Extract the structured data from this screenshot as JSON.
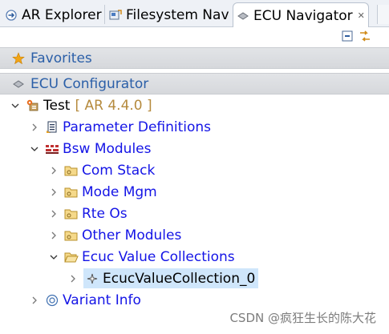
{
  "tabs": [
    {
      "label": "AR Explorer",
      "icon": "ar-explorer-icon"
    },
    {
      "label": "Filesystem Nav",
      "icon": "filesystem-icon"
    },
    {
      "label": "ECU Navigator",
      "icon": "ecu-navigator-icon",
      "active": true
    }
  ],
  "toolbar": {
    "collapse_icon": "collapse-all-icon",
    "link_icon": "link-editor-icon"
  },
  "sections": {
    "favorites": "Favorites",
    "ecu_configurator": "ECU Configurator"
  },
  "tree": {
    "root": {
      "label": "Test",
      "sub": "[ AR 4.4.0 ]"
    },
    "parameter_definitions": "Parameter Definitions",
    "bsw_modules": "Bsw Modules",
    "com_stack": "Com Stack",
    "mode_mgm": "Mode Mgm",
    "rte_os": "Rte Os",
    "other_modules": "Other Modules",
    "ecuc_value_collections": "Ecuc Value Collections",
    "ecuc_value_collection_0": "EcucValueCollection_0",
    "variant_info": "Variant Info"
  },
  "watermark": "CSDN @疯狂生长的陈大花",
  "colors": {
    "link": "#1414e6",
    "section_text": "#2b5fa8",
    "selection": "#cfe6fb",
    "version": "#b58a3d"
  }
}
